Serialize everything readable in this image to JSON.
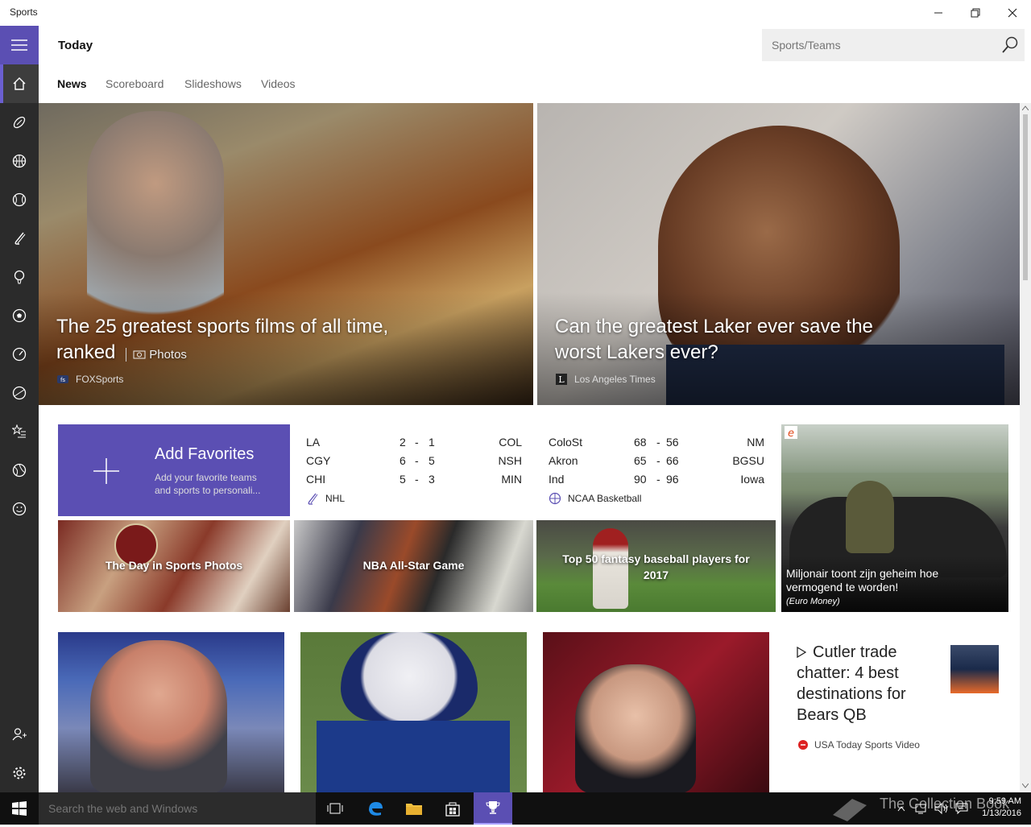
{
  "window": {
    "title": "Sports"
  },
  "header": {
    "title": "Today",
    "search_placeholder": "Sports/Teams",
    "tabs": [
      "News",
      "Scoreboard",
      "Slideshows",
      "Videos"
    ]
  },
  "hero": [
    {
      "caption": "The 25 greatest sports films of all time, ranked",
      "photos_label": "Photos",
      "source": "FOXSports"
    },
    {
      "caption": "Can the greatest Laker ever save the worst Lakers ever?",
      "source": "Los Angeles Times"
    }
  ],
  "add_favorites": {
    "title": "Add Favorites",
    "subtitle": "Add your favorite teams and sports to personali..."
  },
  "scoreboards": [
    {
      "league": "NHL",
      "games": [
        {
          "home": "LA",
          "home_score": "2",
          "away_score": "1",
          "away": "COL"
        },
        {
          "home": "CGY",
          "home_score": "6",
          "away_score": "5",
          "away": "NSH"
        },
        {
          "home": "CHI",
          "home_score": "5",
          "away_score": "3",
          "away": "MIN"
        }
      ]
    },
    {
      "league": "NCAA Basketball",
      "games": [
        {
          "home": "ColoSt",
          "home_score": "68",
          "away_score": "56",
          "away": "NM"
        },
        {
          "home": "Akron",
          "home_score": "65",
          "away_score": "66",
          "away": "BGSU"
        },
        {
          "home": "Ind",
          "home_score": "90",
          "away_score": "96",
          "away": "Iowa"
        }
      ]
    }
  ],
  "photo_tiles": [
    {
      "caption": "The Day in Sports Photos"
    },
    {
      "caption": "NBA All-Star Game"
    },
    {
      "caption": "Top 50 fantasy baseball players for 2017"
    }
  ],
  "ad_tile": {
    "caption": "Miljonair toont zijn geheim hoe vermogend te worden!",
    "source": "(Euro Money)"
  },
  "story_card": {
    "title": "Cutler trade chatter: 4 best destinations for Bears QB",
    "source": "USA Today Sports Video"
  },
  "taskbar": {
    "search_placeholder": "Search the web and Windows",
    "time": "9:59 AM",
    "date": "1/13/2016",
    "watermark": "The Collection Book"
  },
  "colors": {
    "accent": "#5b4fb3",
    "rail": "#2b2b2b",
    "taskbar": "#101010"
  }
}
